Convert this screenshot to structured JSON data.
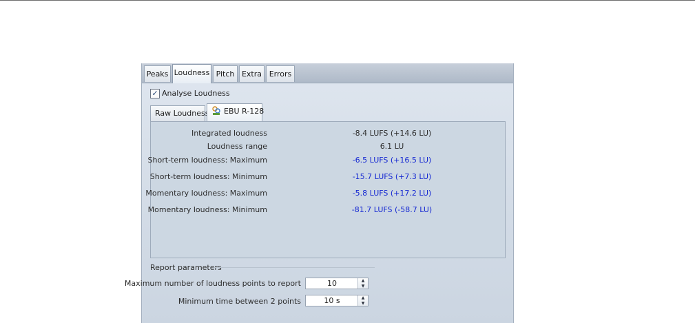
{
  "tabs": [
    {
      "label": "Peaks",
      "active": false
    },
    {
      "label": "Loudness",
      "active": true
    },
    {
      "label": "Pitch",
      "active": false
    },
    {
      "label": "Extra",
      "active": false
    },
    {
      "label": "Errors",
      "active": false
    }
  ],
  "analyse": {
    "label": "Analyse Loudness",
    "checked": true
  },
  "subtabs": [
    {
      "label": "Raw Loudness",
      "active": false
    },
    {
      "label": "EBU R-128",
      "active": true,
      "icon": "ebu-meter-icon"
    }
  ],
  "results": [
    {
      "label": "Integrated loudness",
      "value": "-8.4 LUFS (+14.6 LU)",
      "color": "#2c2c2c"
    },
    {
      "label": "Loudness range",
      "value": "6.1 LU",
      "color": "#2c2c2c"
    },
    {
      "label": "Short-term loudness: Maximum",
      "value": "-6.5 LUFS (+16.5 LU)",
      "color": "#1528d2"
    },
    {
      "label": "Short-term loudness: Minimum",
      "value": "-15.7 LUFS (+7.3 LU)",
      "color": "#1528d2"
    },
    {
      "label": "Momentary loudness: Maximum",
      "value": "-5.8 LUFS (+17.2 LU)",
      "color": "#1528d2"
    },
    {
      "label": "Momentary loudness: Minimum",
      "value": "-81.7 LUFS (-58.7 LU)",
      "color": "#1528d2"
    }
  ],
  "report": {
    "title": "Report parameters",
    "max_points_label": "Maximum number of loudness points to report",
    "max_points_value": "10",
    "min_time_label": "Minimum time between 2 points",
    "min_time_value": "10 s"
  }
}
